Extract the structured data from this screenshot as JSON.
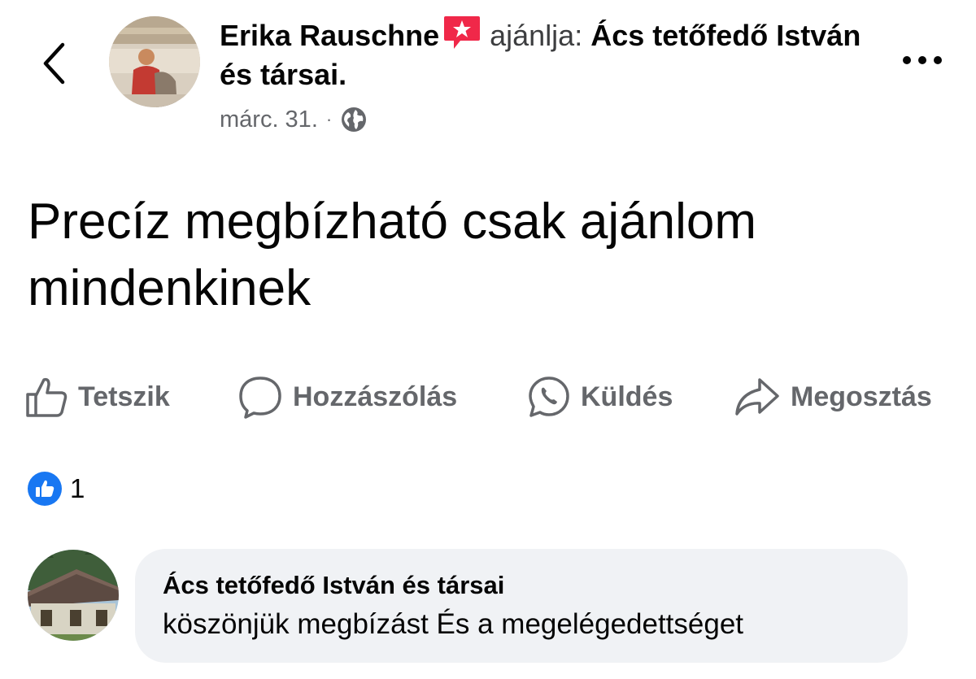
{
  "header": {
    "author": "Erika Rauschne",
    "verb": "ajánlja:",
    "page_name": "Ács tetőfedő István és társai.",
    "date": "márc. 31.",
    "separator": "·",
    "icons": {
      "back": "chevron-left-icon",
      "more": "more-horizontal-icon",
      "badge": "star-badge-icon",
      "audience": "globe-icon"
    }
  },
  "post": {
    "text": "Precíz megbízható csak ajánlom mindenkinek"
  },
  "actions": [
    {
      "label": "Tetszik",
      "icon": "thumbs-up-icon"
    },
    {
      "label": "Hozzászólás",
      "icon": "comment-icon"
    },
    {
      "label": "Küldés",
      "icon": "whatsapp-icon"
    },
    {
      "label": "Megosztás",
      "icon": "share-icon"
    }
  ],
  "reactions": {
    "count": "1",
    "icon": "like-reaction-icon"
  },
  "comment": {
    "author": "Ács tetőfedő István és társai",
    "text": "köszönjük megbízást És  a megelégedettséget"
  },
  "colors": {
    "accent": "#1877f2",
    "secondary_text": "#65676b",
    "badge": "#f02849",
    "bubble": "#f0f2f5"
  }
}
